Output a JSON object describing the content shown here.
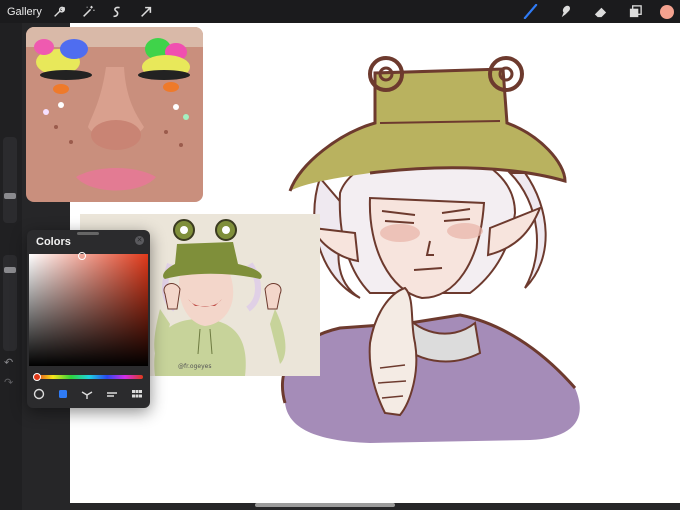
{
  "topbar": {
    "gallery_label": "Gallery",
    "left_tools": [
      "wrench-icon",
      "magic-wand-icon",
      "selection-icon",
      "transform-arrow-icon"
    ],
    "right_tools": [
      "brush-icon",
      "smudge-icon",
      "eraser-icon",
      "layers-icon"
    ],
    "current_color": "#f4a28f",
    "active_tool_color": "#2f7bf5"
  },
  "sidebar": {
    "controls": [
      "brush-size-slider",
      "modify-button",
      "opacity-slider",
      "undo-button",
      "redo-button"
    ]
  },
  "colors_panel": {
    "title": "Colors",
    "hue_color": "#e0391a",
    "tabs": [
      "disc",
      "classic",
      "harmony",
      "value",
      "palettes"
    ],
    "active_tab": "classic"
  },
  "reference_image_2": {
    "watermark": "@fr.ogeyes"
  }
}
